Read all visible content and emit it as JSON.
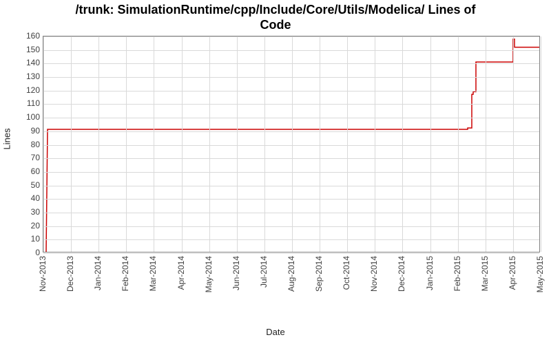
{
  "title_line1": "/trunk: SimulationRuntime/cpp/Include/Core/Utils/Modelica/ Lines of",
  "title_line2": "Code",
  "ylabel": "Lines",
  "xlabel": "Date",
  "chart_data": {
    "type": "line",
    "title": "/trunk: SimulationRuntime/cpp/Include/Core/Utils/Modelica/ Lines of Code",
    "xlabel": "Date",
    "ylabel": "Lines",
    "ylim": [
      0,
      160
    ],
    "y_ticks": [
      0,
      10,
      20,
      30,
      40,
      50,
      60,
      70,
      80,
      90,
      100,
      110,
      120,
      130,
      140,
      150,
      160
    ],
    "x_categories": [
      "Nov-2013",
      "Dec-2013",
      "Jan-2014",
      "Feb-2014",
      "Mar-2014",
      "Apr-2014",
      "May-2014",
      "Jun-2014",
      "Jul-2014",
      "Aug-2014",
      "Sep-2014",
      "Oct-2014",
      "Nov-2014",
      "Dec-2014",
      "Jan-2015",
      "Feb-2015",
      "Mar-2015",
      "Apr-2015",
      "May-2015"
    ],
    "series": [
      {
        "name": "Lines of Code",
        "color": "#cc0000",
        "points": [
          {
            "xi": 0.1,
            "y": 0
          },
          {
            "xi": 0.15,
            "y": 91
          },
          {
            "xi": 15.4,
            "y": 91
          },
          {
            "xi": 15.4,
            "y": 92
          },
          {
            "xi": 15.55,
            "y": 92
          },
          {
            "xi": 15.55,
            "y": 117
          },
          {
            "xi": 15.6,
            "y": 117
          },
          {
            "xi": 15.6,
            "y": 119
          },
          {
            "xi": 15.7,
            "y": 119
          },
          {
            "xi": 15.7,
            "y": 141
          },
          {
            "xi": 17.05,
            "y": 141
          },
          {
            "xi": 17.05,
            "y": 158
          },
          {
            "xi": 17.1,
            "y": 158
          },
          {
            "xi": 17.1,
            "y": 152
          },
          {
            "xi": 18.0,
            "y": 152
          }
        ]
      }
    ]
  }
}
